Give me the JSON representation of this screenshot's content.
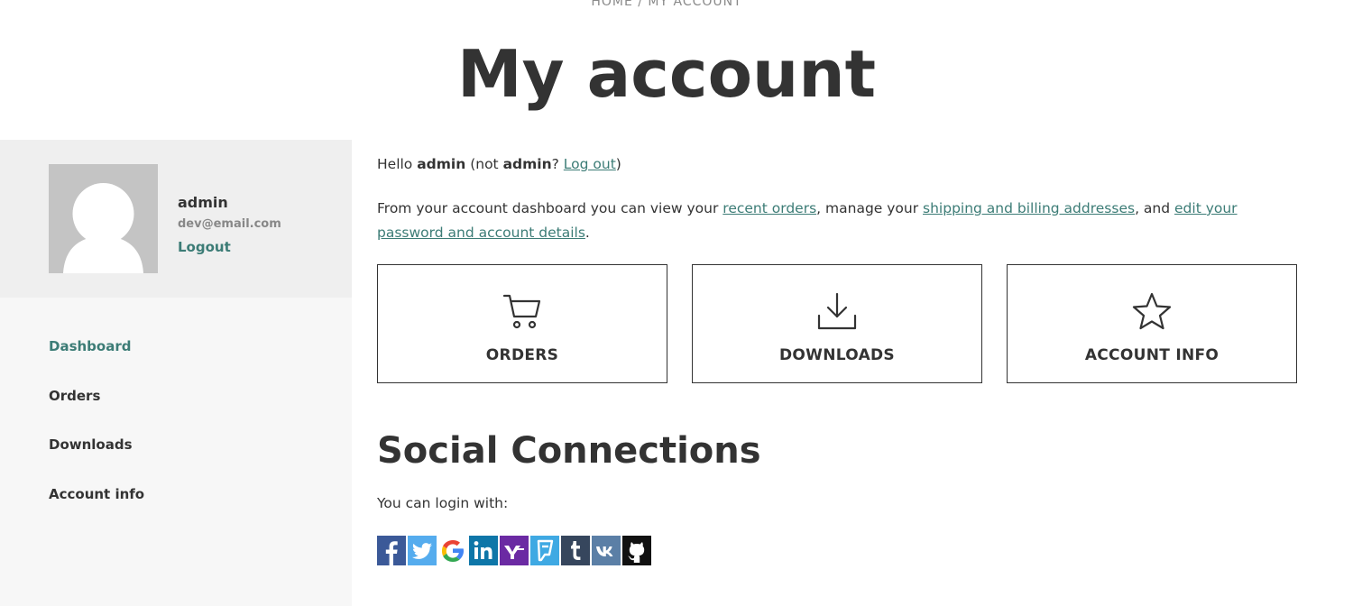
{
  "breadcrumb": "HOME / MY ACCOUNT",
  "page_title": "My account",
  "profile": {
    "name": "admin",
    "email": "dev@email.com",
    "logout": "Logout"
  },
  "nav": {
    "items": [
      {
        "label": "Dashboard",
        "active": true
      },
      {
        "label": "Orders",
        "active": false
      },
      {
        "label": "Downloads",
        "active": false
      },
      {
        "label": "Account info",
        "active": false
      }
    ]
  },
  "hello": {
    "prefix": "Hello ",
    "user": "admin",
    "middle": " (not ",
    "user2": "admin",
    "question": "? ",
    "logout_link": "Log out",
    "suffix": ")"
  },
  "intro": {
    "t1": "From your account dashboard you can view your ",
    "link1": "recent orders",
    "t2": ", manage your ",
    "link2": "shipping and billing addresses",
    "t3": ", and ",
    "link3": "edit your password and account details",
    "t4": "."
  },
  "cards": [
    {
      "label": "ORDERS",
      "icon": "cart-icon"
    },
    {
      "label": "DOWNLOADS",
      "icon": "download-icon"
    },
    {
      "label": "ACCOUNT INFO",
      "icon": "star-icon"
    }
  ],
  "social": {
    "title": "Social Connections",
    "login_with": "You can login with:",
    "providers": [
      {
        "name": "facebook",
        "color": "#3b5998"
      },
      {
        "name": "twitter",
        "color": "#55acee"
      },
      {
        "name": "google",
        "color": "#ffffff"
      },
      {
        "name": "linkedin",
        "color": "#0e76a8"
      },
      {
        "name": "yahoo",
        "color": "#6b2aa3"
      },
      {
        "name": "foursquare",
        "color": "#3fa9e3"
      },
      {
        "name": "tumblr",
        "color": "#36465d"
      },
      {
        "name": "vk",
        "color": "#5b7fa6"
      },
      {
        "name": "github",
        "color": "#111111"
      }
    ]
  },
  "colors": {
    "accent": "#3c7c76",
    "text": "#333333",
    "sidebar_bg": "#f7f7f7",
    "profile_bg": "#efefef"
  }
}
